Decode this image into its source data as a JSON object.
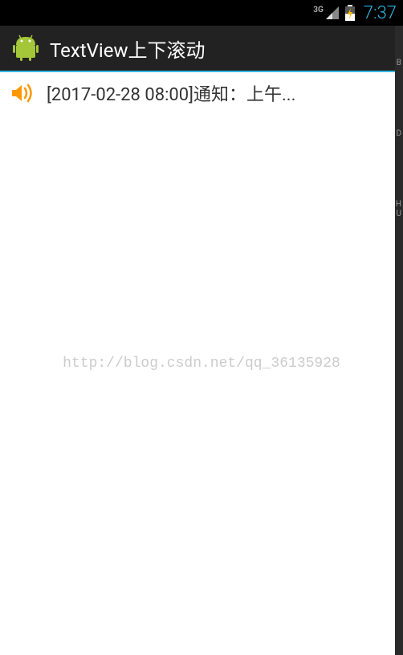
{
  "statusBar": {
    "networkType": "3G",
    "time": "7:37"
  },
  "actionBar": {
    "title": "TextView上下滚动"
  },
  "notification": {
    "text": "[2017-02-28  08:00]通知：上午..."
  },
  "watermark": "http://blog.csdn.net/qq_36135928",
  "edgeLabels": {
    "b": "B",
    "d": "D",
    "h": "H",
    "u": "U"
  }
}
